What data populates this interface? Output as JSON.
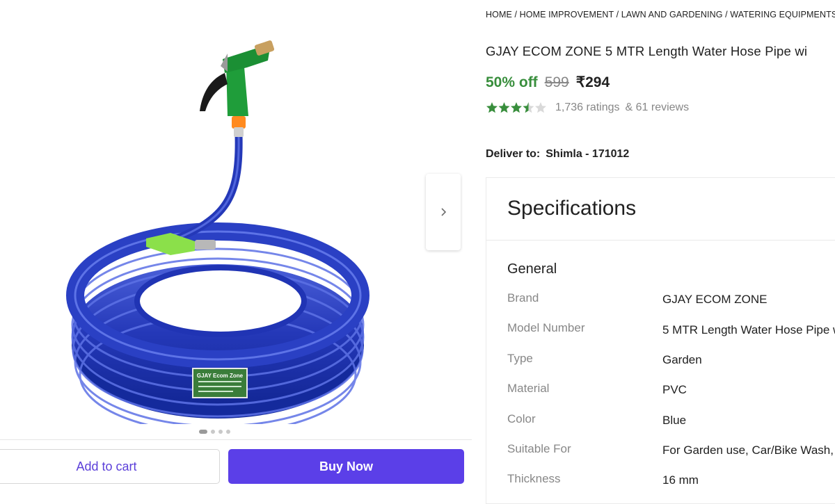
{
  "breadcrumb": "HOME / HOME IMPROVEMENT / LAWN AND GARDENING / WATERING EQUIPMENTS",
  "product": {
    "title": "GJAY ECOM ZONE 5 MTR Length Water Hose Pipe wi",
    "discount": "50% off",
    "mrp": "599",
    "price": "₹294",
    "rating": 3.5,
    "ratings_count": "1,736 ratings",
    "reviews_count": "& 61 reviews",
    "image_label": {
      "brand": "GJAY Ecom Zone"
    }
  },
  "delivery": {
    "label": "Deliver to:",
    "location": "Shimla - 171012"
  },
  "gallery": {
    "dots": 4,
    "active_index": 0
  },
  "actions": {
    "add_to_cart": "Add to cart",
    "buy_now": "Buy Now"
  },
  "specifications": {
    "title": "Specifications",
    "group": "General",
    "rows": [
      {
        "key": "Brand",
        "value": "GJAY ECOM ZONE"
      },
      {
        "key": "Model Number",
        "value": "5 MTR Length Water Hose Pipe w"
      },
      {
        "key": "Type",
        "value": "Garden"
      },
      {
        "key": "Material",
        "value": "PVC"
      },
      {
        "key": "Color",
        "value": "Blue"
      },
      {
        "key": "Suitable For",
        "value": "For Garden use, Car/Bike Wash, l"
      },
      {
        "key": "Thickness",
        "value": "16 mm"
      }
    ]
  },
  "colors": {
    "accent": "#5b3fe8",
    "discount_green": "#388e3c",
    "star_green": "#388e3c"
  }
}
